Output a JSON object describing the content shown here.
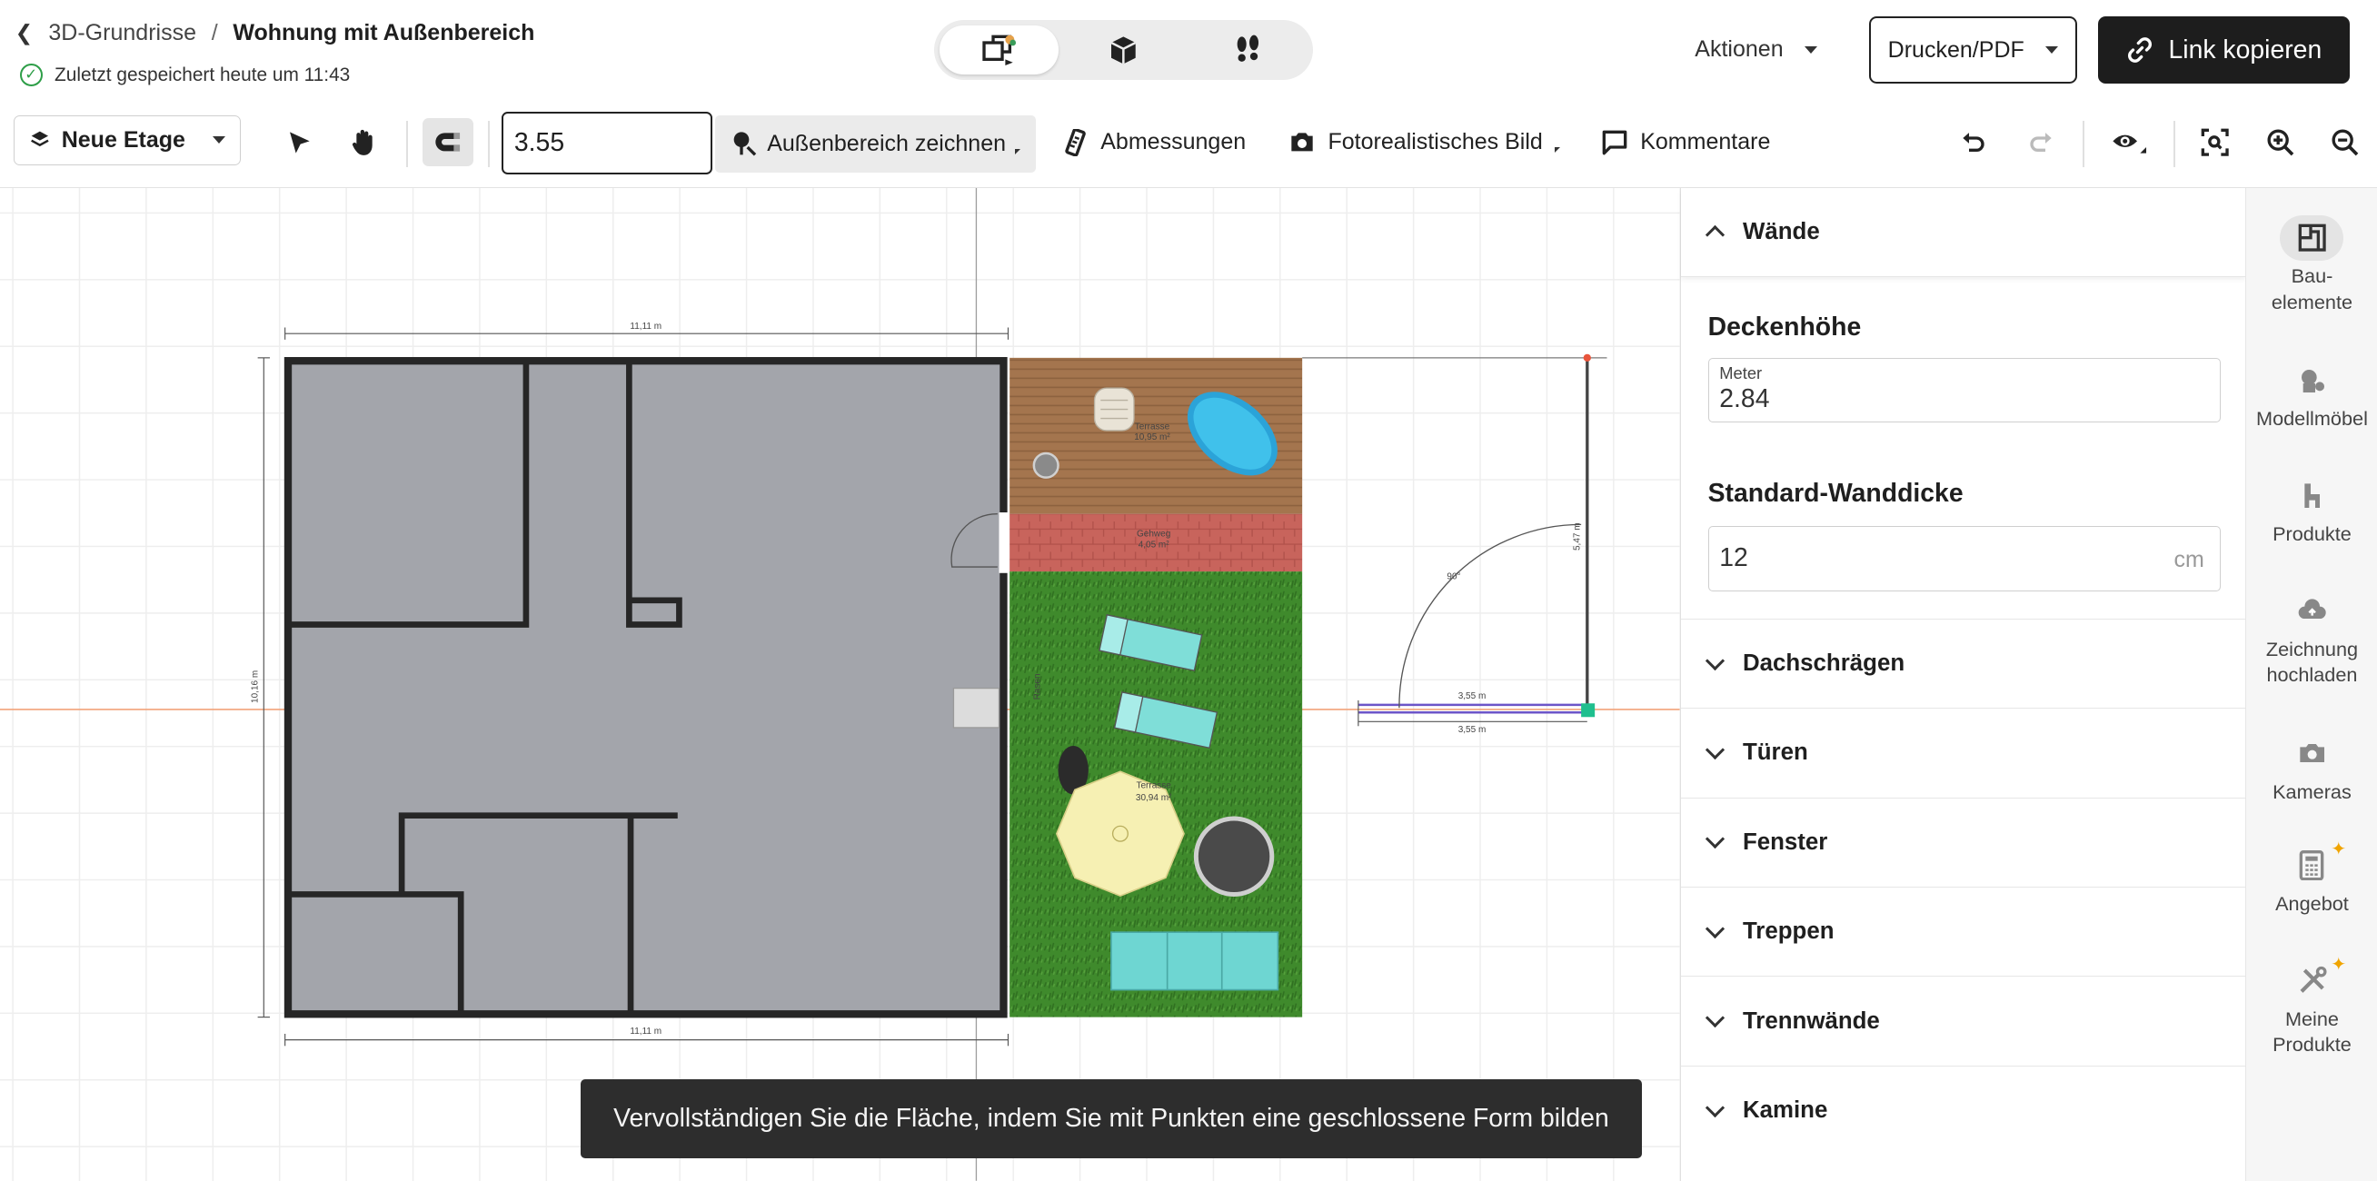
{
  "header": {
    "back_label": "3D-Grundrisse",
    "separator": "/",
    "project_title": "Wohnung mit Außenbereich",
    "saved_status": "Zuletzt gespeichert heute um 11:43",
    "actions_label": "Aktionen",
    "print_label": "Drucken/PDF",
    "copy_link_label": "Link kopieren"
  },
  "view_modes": [
    "2d-plan-icon",
    "3d-box-icon",
    "walk-footsteps-icon"
  ],
  "toolbar": {
    "floor_label": "Neue Etage",
    "length_input_value": "3.55",
    "outside_area_label": "Außenbereich zeichnen",
    "dimensions_label": "Abmessungen",
    "photo_label": "Fotorealistisches Bild",
    "comments_label": "Kommentare"
  },
  "plan": {
    "dim_top": "11,11 m",
    "dim_bottom": "11,11 m",
    "dim_left": "10,16 m",
    "terrace1_name": "Terrasse",
    "terrace1_area": "10,95 m²",
    "path_name": "Gehweg",
    "path_area": "4,05 m²",
    "terrace2_name": "Terrasse",
    "terrace2_area": "30,94 m²",
    "lawn_label": "Rasen",
    "angle_label": "90°",
    "wall_len_vertical": "5,47 m",
    "wall_len_top": "3,55 m",
    "wall_len_bottom": "3,55 m"
  },
  "hint_text": "Vervollständigen Sie die Fläche, indem Sie mit Punkten eine geschlossene Form bilden",
  "panel": {
    "open_section": "Wände",
    "ceiling_height_label": "Deckenhöhe",
    "ceiling_unit_label": "Meter",
    "ceiling_height_value": "2.84",
    "wall_thickness_label": "Standard-Wanddicke",
    "wall_thickness_value": "12",
    "wall_thickness_unit": "cm",
    "sections": [
      "Dachschrägen",
      "Türen",
      "Fenster",
      "Treppen",
      "Trennwände",
      "Kamine"
    ]
  },
  "rail": [
    {
      "line1": "Bau-",
      "line2": "elemente",
      "icon": "building-elements-icon"
    },
    {
      "line1": "Modellmöbel",
      "line2": "",
      "icon": "furniture-icon"
    },
    {
      "line1": "Produkte",
      "line2": "",
      "icon": "chair-icon"
    },
    {
      "line1": "Zeichnung",
      "line2": "hochladen",
      "icon": "cloud-upload-icon"
    },
    {
      "line1": "Kameras",
      "line2": "",
      "icon": "camera-icon"
    },
    {
      "line1": "Angebot",
      "line2": "",
      "icon": "calculator-icon"
    },
    {
      "line1": "Meine",
      "line2": "Produkte",
      "icon": "tools-icon"
    }
  ],
  "colors": {
    "accent_dark": "#1d1d1d",
    "floor_gray": "#a3a5ab",
    "deck_brown": "#a4754e",
    "lawn_green": "#3f8a2c",
    "guide_orange": "#f2a37a",
    "saved_green": "#2e9e48"
  }
}
